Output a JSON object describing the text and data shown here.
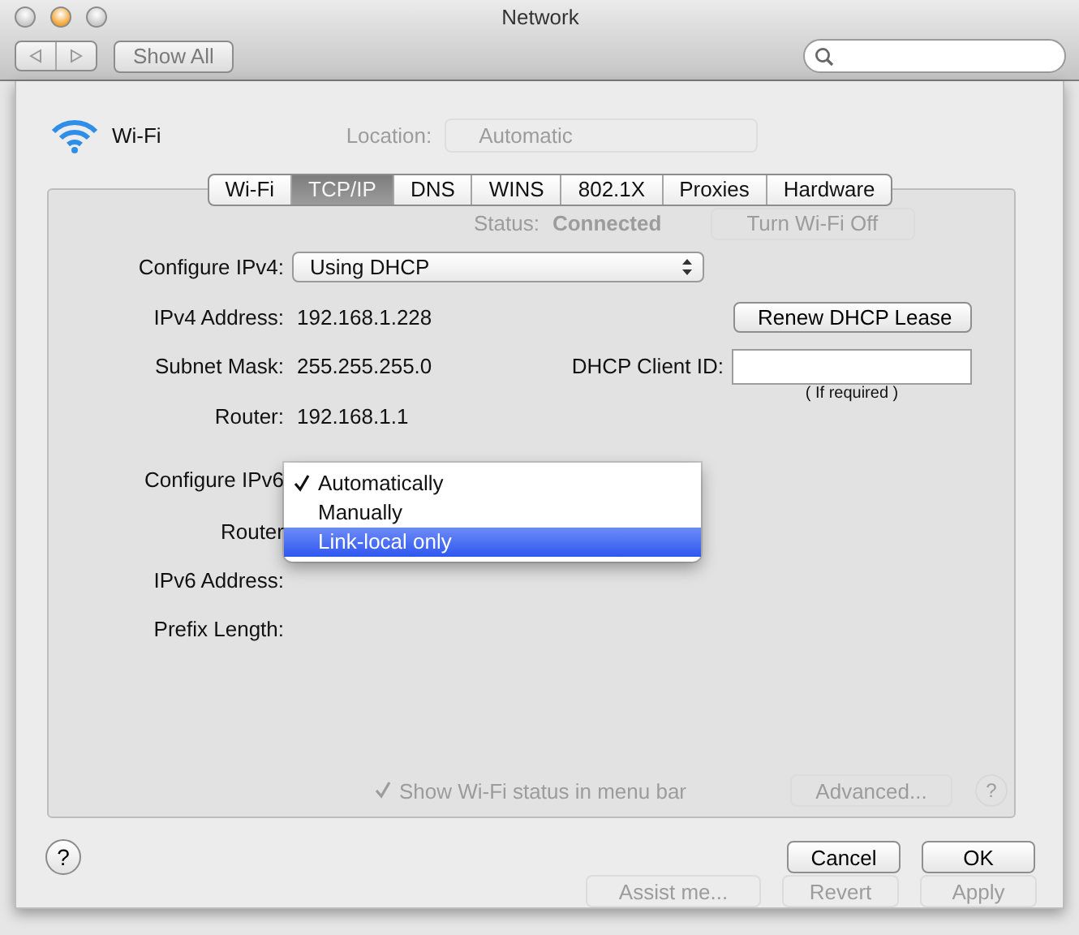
{
  "window": {
    "title": "Network",
    "traffic_lights": [
      {
        "kind": "close"
      },
      {
        "kind": "minimize"
      },
      {
        "kind": "zoom"
      }
    ]
  },
  "toolbar": {
    "show_all": "Show All"
  },
  "header": {
    "service": "Wi-Fi",
    "location_label": "Location:",
    "location_value": "Automatic"
  },
  "tabs": [
    {
      "label": "Wi-Fi",
      "selected": false
    },
    {
      "label": "TCP/IP",
      "selected": true
    },
    {
      "label": "DNS",
      "selected": false
    },
    {
      "label": "WINS",
      "selected": false
    },
    {
      "label": "802.1X",
      "selected": false
    },
    {
      "label": "Proxies",
      "selected": false
    },
    {
      "label": "Hardware",
      "selected": false
    }
  ],
  "background": {
    "status_label": "Status:",
    "status_value": "Connected",
    "turn_off": "Turn Wi-Fi Off",
    "show_status": {
      "label": "Show Wi-Fi status in menu bar",
      "checked": true
    },
    "advanced": "Advanced...",
    "help": "?",
    "assist": "Assist me...",
    "revert": "Revert",
    "apply": "Apply"
  },
  "form": {
    "configure_ipv4": {
      "label": "Configure IPv4:",
      "value": "Using DHCP"
    },
    "ipv4_address": {
      "label": "IPv4 Address:",
      "value": "192.168.1.228"
    },
    "renew": "Renew DHCP Lease",
    "subnet_mask": {
      "label": "Subnet Mask:",
      "value": "255.255.255.0"
    },
    "client_id": {
      "label": "DHCP Client ID:",
      "note": "( If required )"
    },
    "router": {
      "label": "Router:",
      "value": "192.168.1.1"
    },
    "configure_ipv6": {
      "label": "Configure IPv6"
    },
    "router6": {
      "label": "Router"
    },
    "ipv6_address": {
      "label": "IPv6 Address:"
    },
    "prefix_length": {
      "label": "Prefix Length:"
    }
  },
  "ipv6_menu": [
    {
      "label": "Automatically",
      "checked": true,
      "selected": false
    },
    {
      "label": "Manually",
      "checked": false,
      "selected": false
    },
    {
      "label": "Link-local only",
      "checked": false,
      "selected": true
    }
  ],
  "buttons": {
    "help": "?",
    "cancel": "Cancel",
    "ok": "OK"
  }
}
